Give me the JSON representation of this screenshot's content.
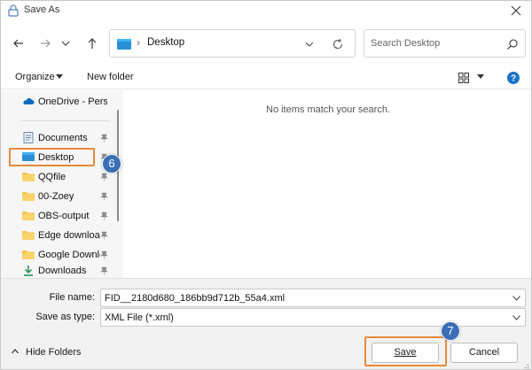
{
  "window": {
    "title": "Save As",
    "close_icon": "close-icon"
  },
  "nav": {
    "back_icon": "arrow-left-icon",
    "forward_icon": "arrow-right-icon",
    "dropdown_icon": "chevron-down-icon",
    "up_icon": "arrow-up-icon"
  },
  "address": {
    "path_separator": "›",
    "location": "Desktop",
    "refresh_icon": "refresh-icon"
  },
  "search": {
    "placeholder": "Search Desktop",
    "icon": "search-icon"
  },
  "toolbar": {
    "organize_label": "Organize",
    "new_folder_label": "New folder",
    "view_icon": "grid-view-icon",
    "help_icon": "help-icon"
  },
  "sidebar": {
    "items": [
      {
        "label": "OneDrive - Personal",
        "icon": "cloud-icon",
        "pinned": false
      },
      {
        "label": "Documents",
        "icon": "document-icon",
        "pinned": true
      },
      {
        "label": "Desktop",
        "icon": "desktop-icon",
        "pinned": true,
        "selected": true
      },
      {
        "label": "QQfile",
        "icon": "folder-icon",
        "pinned": true
      },
      {
        "label": "00-Zoey",
        "icon": "folder-icon",
        "pinned": true
      },
      {
        "label": "OBS-output",
        "icon": "folder-icon",
        "pinned": true
      },
      {
        "label": "Edge downloads",
        "icon": "folder-icon",
        "pinned": true
      },
      {
        "label": "Google Downloads",
        "icon": "folder-icon",
        "pinned": true
      },
      {
        "label": "Downloads",
        "icon": "download-icon",
        "pinned": true
      }
    ]
  },
  "main": {
    "empty_message": "No items match your search."
  },
  "fields": {
    "file_name_label": "File name:",
    "file_name_value": "FID__2180d680_186bb9d712b_55a4.xml",
    "save_type_label": "Save as type:",
    "save_type_value": "XML File (*.xml)"
  },
  "footer": {
    "hide_folders_label": "Hide Folders",
    "save_label": "Save",
    "cancel_label": "Cancel"
  },
  "annotations": {
    "step_desktop": "6",
    "step_save": "7",
    "highlight_color": "#e8893a",
    "badge_color": "#3b6fb6"
  }
}
